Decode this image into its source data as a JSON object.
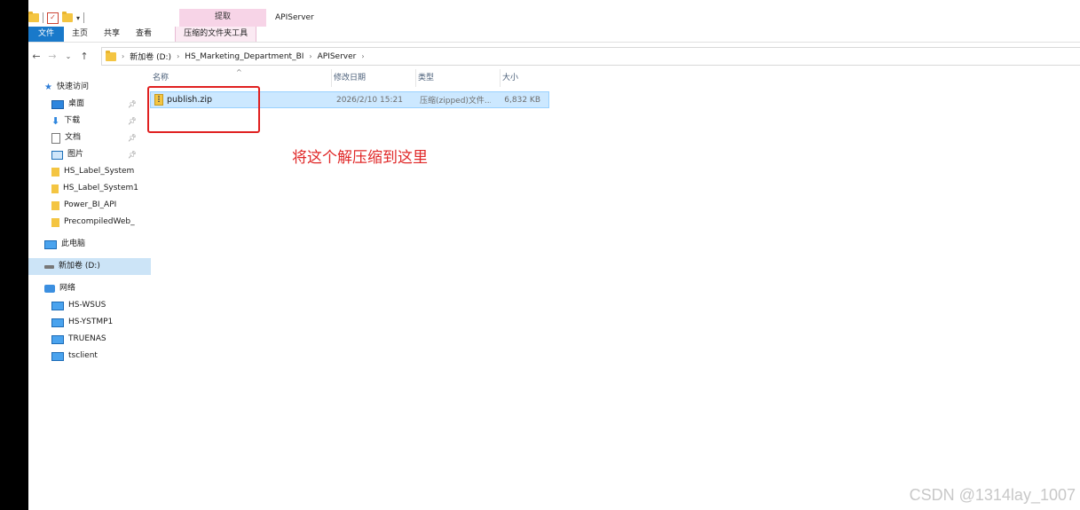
{
  "window": {
    "title": "APIServer",
    "context_tab_group": "提取"
  },
  "ribbon": {
    "tabs": [
      {
        "label": "文件"
      },
      {
        "label": "主页"
      },
      {
        "label": "共享"
      },
      {
        "label": "查看"
      }
    ],
    "context_tab": "压缩的文件夹工具"
  },
  "address": {
    "crumbs": [
      "新加卷 (D:)",
      "HS_Marketing_Department_BI",
      "APIServer"
    ]
  },
  "sidebar": {
    "quick_access": "快速访问",
    "pinned": [
      {
        "label": "桌面",
        "icon": "desktop-icon"
      },
      {
        "label": "下载",
        "icon": "download-icon"
      },
      {
        "label": "文档",
        "icon": "document-icon"
      },
      {
        "label": "图片",
        "icon": "picture-icon"
      }
    ],
    "recent": [
      "HS_Label_System",
      "HS_Label_System1",
      "Power_BI_API",
      "PrecompiledWeb_"
    ],
    "this_pc": "此电脑",
    "drive": "新加卷 (D:)",
    "network": "网络",
    "network_items": [
      "HS-WSUS",
      "HS-YSTMP1",
      "TRUENAS",
      "tsclient"
    ]
  },
  "file_list": {
    "columns": [
      "名称",
      "修改日期",
      "类型",
      "大小"
    ],
    "rows": [
      {
        "name": "publish.zip",
        "modified": "2026/2/10 15:21",
        "type": "压缩(zipped)文件...",
        "size": "6,832 KB"
      }
    ]
  },
  "annotation": {
    "text": "将这个解压缩到这里",
    "color": "#e02828"
  },
  "credit": "CSDN @1314lay_1007"
}
